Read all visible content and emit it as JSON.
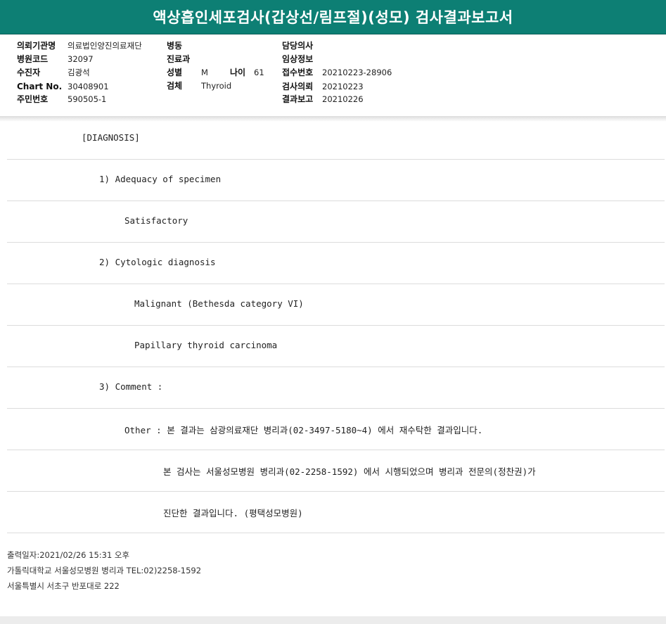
{
  "title": "액상흡인세포검사(갑상선/림프절)(성모) 검사결과보고서",
  "header": {
    "col1": [
      {
        "label": "의뢰기관명",
        "value": "의료법인양진의료재단"
      },
      {
        "label": "병원코드",
        "value": "32097"
      },
      {
        "label": "수진자",
        "value": "김광석"
      },
      {
        "label": "Chart No.",
        "value": "30408901"
      },
      {
        "label": "주민번호",
        "value": "590505-1"
      }
    ],
    "col2": [
      {
        "label": "병동",
        "value": ""
      },
      {
        "label": "진료과",
        "value": ""
      },
      {
        "label": "성별",
        "value": "M"
      },
      {
        "label": "검체",
        "value": "Thyroid"
      }
    ],
    "age": {
      "label": "나이",
      "value": "61"
    },
    "col3": [
      {
        "label": "담당의사",
        "value": ""
      },
      {
        "label": "임상정보",
        "value": ""
      },
      {
        "label": "접수번호",
        "value": "20210223-28906"
      },
      {
        "label": "검사의뢰",
        "value": "20210223"
      },
      {
        "label": "결과보고",
        "value": "20210226"
      }
    ]
  },
  "diagnosis": [
    "[DIAGNOSIS]",
    "1) Adequacy of specimen",
    "Satisfactory",
    "2) Cytologic diagnosis",
    "Malignant (Bethesda category VI)",
    "Papillary thyroid carcinoma",
    "3) Comment :",
    "Other : 본 결과는 삼광의료재단 병리과(02-3497-5180~4) 에서 재수탁한 결과입니다.",
    "본 검사는 서울성모병원 병리과(02-2258-1592) 에서 시행되었으며 병리과 전문의(정찬권)가",
    "진단한 결과입니다. (평택성모병원)"
  ],
  "footer": {
    "printed": "출력일자:2021/02/26 15:31 오후",
    "hospital": "가톨릭대학교 서울성모병원 병리과 TEL:02)2258-1592",
    "address": "서울특별시 서초구 반포대로 222"
  }
}
